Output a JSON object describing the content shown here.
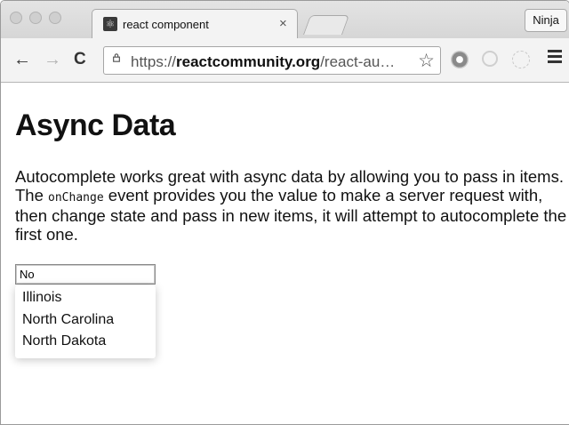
{
  "browser": {
    "tab_title": "react component",
    "tab_close": "×",
    "profile_label": "Ninja",
    "url_scheme": "https://",
    "url_host": "reactcommunity.org",
    "url_path": "/react-au…",
    "back_glyph": "←",
    "forward_glyph": "→",
    "reload_glyph": "C",
    "star_glyph": "☆",
    "icons": [
      "back-icon",
      "forward-icon",
      "reload-icon",
      "lock-icon",
      "star-icon",
      "extension-icon",
      "menu-icon"
    ]
  },
  "page": {
    "heading": "Async Data",
    "paragraph_before": "Autocomplete works great with async data by allowing you to pass in items. The ",
    "paragraph_code": "onChange",
    "paragraph_after": " event provides you the value to make a server request with, then change state and pass in new items, it will attempt to autocomplete the first one."
  },
  "autocomplete": {
    "value": "No",
    "items": [
      "Illinois",
      "North Carolina",
      "North Dakota"
    ]
  }
}
